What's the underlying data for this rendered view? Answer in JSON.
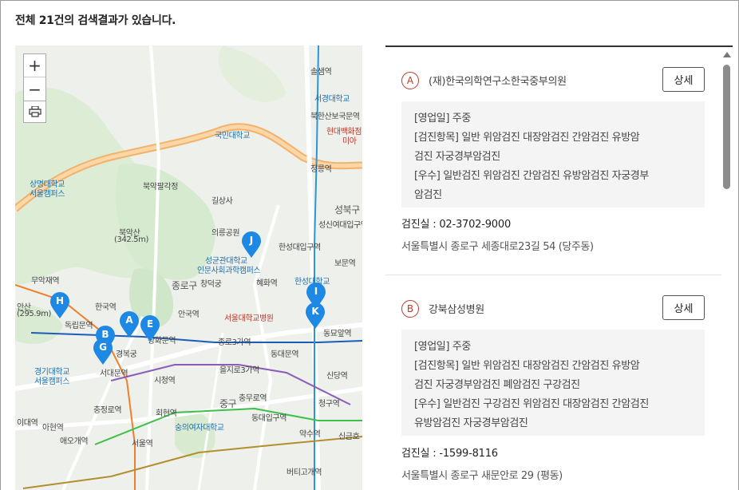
{
  "summary": "전체 21건의 검색결과가 있습니다.",
  "map": {
    "zoom_in": "+",
    "zoom_out": "−",
    "labels": [
      "솔샘역",
      "서경대학교",
      "북한산보국문역",
      "현대백화점",
      "미아",
      "국민대학교",
      "정릉역",
      "성신여대입구역",
      "상명대학교",
      "서울캠퍼스",
      "북악팔각정",
      "길상사",
      "성북구",
      "북악산",
      "(342.5m)",
      "의릉공원",
      "한성대입구역",
      "성균관대학교",
      "인문사회과학캠퍼스",
      "보문역",
      "종로구",
      "창덕궁",
      "혜화역",
      "한성대학교",
      "무악재역",
      "한국역",
      "안산",
      "(295.9m)",
      "독립문역",
      "안국역",
      "서울대학교병원",
      "동묘앞역",
      "경복궁",
      "광화문역",
      "종로3가역",
      "동대문역",
      "서대문역",
      "시청역",
      "을지로3가역",
      "신당역",
      "경기대학교",
      "서울캠퍼스",
      "충무로역",
      "청구역",
      "충정로역",
      "회현역",
      "동대입구역",
      "중구",
      "숭의여자대학교",
      "약수역",
      "서울역",
      "아현역",
      "애오개역",
      "신금호",
      "이대역",
      "버티고개역"
    ],
    "pins": [
      "A",
      "B",
      "E",
      "G",
      "H",
      "I",
      "J",
      "K"
    ]
  },
  "results": [
    {
      "marker": "A",
      "name": "(재)한국의학연구소한국중부의원",
      "detail_label": "상세",
      "info": [
        "[영업일] 주중",
        "[검진항목] 일반 위암검진 대장암검진 간암검진 유방암",
        "검진 자궁경부암검진",
        "[우수] 일반검진 위암검진 간암검진 유방암검진 자궁경부",
        "암검진"
      ],
      "phone": "검진실 :  02-3702-9000",
      "address": "서울특별시 종로구 세종대로23길 54 (당주동)"
    },
    {
      "marker": "B",
      "name": "강북삼성병원",
      "detail_label": "상세",
      "info": [
        "[영업일] 주중",
        "[검진항목] 일반 위암검진 대장암검진 간암검진 유방암",
        "검진 자궁경부암검진 폐암검진 구강검진",
        "[우수] 일반검진 구강검진 위암검진 대장암검진 간암검진",
        "유방암검진 자궁경부암검진"
      ],
      "phone": "검진실 :  -1599-8116",
      "address": "서울특별시 종로구 새문안로 29 (평동)"
    }
  ],
  "colors": {
    "marker": "#c0392b",
    "pin": "#1e88e5",
    "road": "#f6b26b"
  },
  "icons": [
    "zoom-in-icon",
    "zoom-out-icon",
    "print-icon",
    "map-pin-icon",
    "scroll-up-icon"
  ]
}
